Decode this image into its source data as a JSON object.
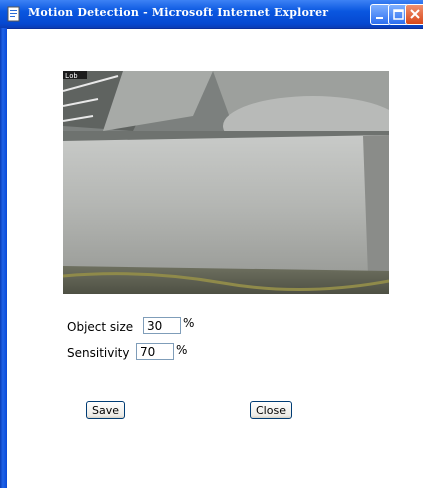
{
  "window": {
    "title": "Motion Detection - Microsoft Internet Explorer"
  },
  "form": {
    "object_size_label": "Object size",
    "object_size_value": "30",
    "object_size_unit": "%",
    "sensitivity_label": "Sensitivity",
    "sensitivity_value": "70",
    "sensitivity_unit": "%"
  },
  "buttons": {
    "save": "Save",
    "close": "Close"
  },
  "camera": {
    "overlay_text": "Lob"
  }
}
